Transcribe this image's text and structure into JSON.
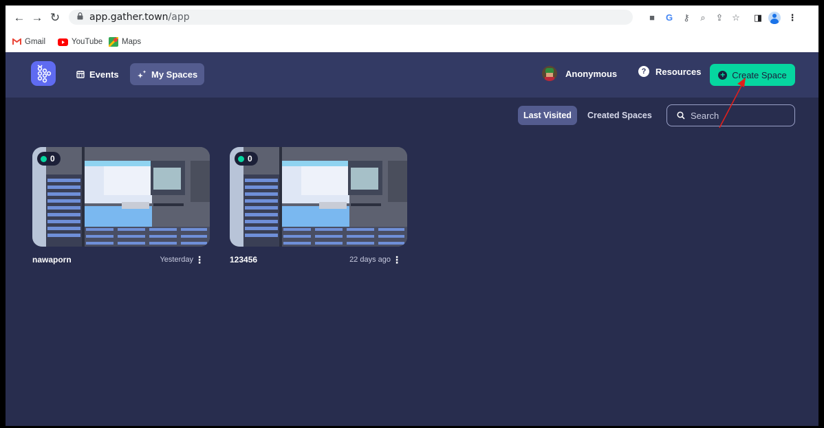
{
  "browser": {
    "url_host": "app.gather.town",
    "url_path": "/app",
    "bookmarks": [
      {
        "label": "Gmail",
        "icon": "gmail-icon"
      },
      {
        "label": "YouTube",
        "icon": "youtube-icon"
      },
      {
        "label": "Maps",
        "icon": "maps-icon"
      }
    ]
  },
  "header": {
    "nav": [
      {
        "label": "Events",
        "icon": "calendar-icon"
      },
      {
        "label": "My Spaces",
        "icon": "sparkles-icon"
      }
    ],
    "user_name": "Anonymous",
    "resources_label": "Resources",
    "create_label": "Create Space"
  },
  "filters": {
    "last_visited": "Last Visited",
    "created_spaces": "Created Spaces",
    "search_placeholder": "Search"
  },
  "spaces": [
    {
      "name": "nawaporn",
      "online": "0",
      "visited": "Yesterday"
    },
    {
      "name": "123456",
      "online": "0",
      "visited": "22 days ago"
    }
  ],
  "colors": {
    "accent": "#06d6a0",
    "background": "#282d4e",
    "header": "#333a64",
    "logo": "#5f6bf1",
    "annotation_arrow": "#e0201c"
  }
}
